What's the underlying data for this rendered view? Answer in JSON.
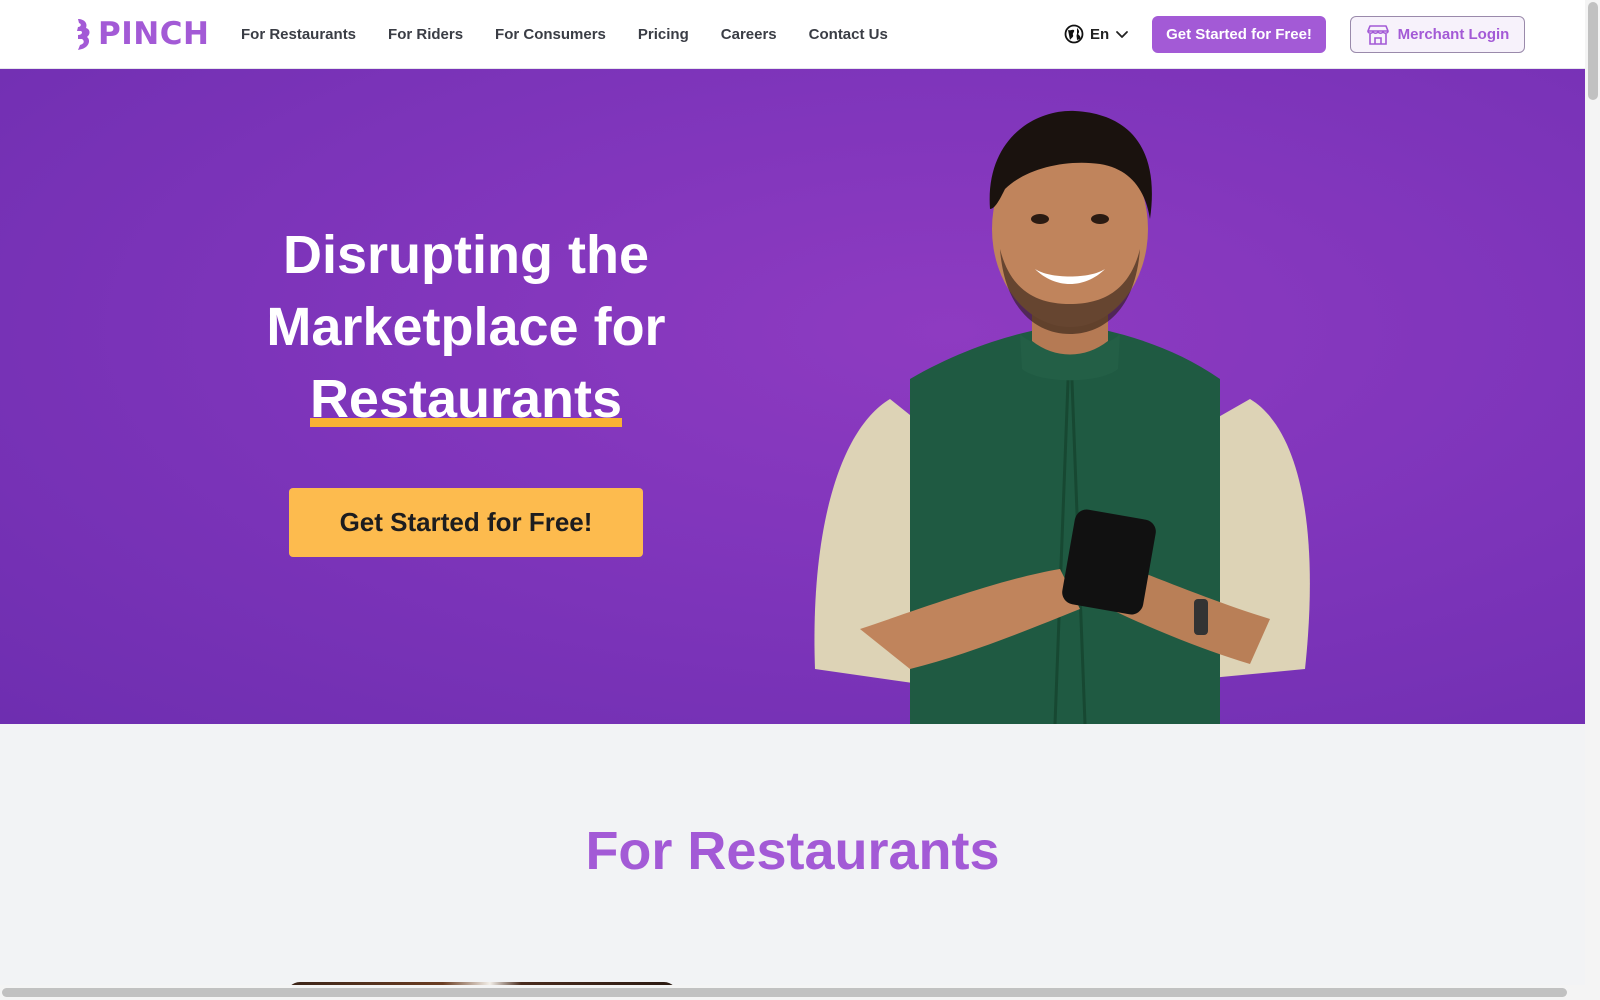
{
  "header": {
    "logo_text": "PINCH",
    "nav": [
      {
        "label": "For Restaurants"
      },
      {
        "label": "For Riders"
      },
      {
        "label": "For Consumers"
      },
      {
        "label": "Pricing"
      },
      {
        "label": "Careers"
      },
      {
        "label": "Contact Us"
      }
    ],
    "language": "En",
    "cta_label": "Get Started for Free!",
    "merchant_login_label": "Merchant Login"
  },
  "hero": {
    "title_line1": "Disrupting the",
    "title_line2": "Marketplace for",
    "title_highlight": "Restaurants",
    "cta_label": "Get Started for Free!"
  },
  "section": {
    "title": "For Restaurants"
  },
  "colors": {
    "brand": "#a35ad6",
    "hero_bg": "#7f35bb",
    "accent": "#fdbb4e",
    "highlight": "#f9b233"
  },
  "icons": [
    "pinch-logo-icon",
    "globe-icon",
    "chevron-down-icon",
    "storefront-icon"
  ]
}
